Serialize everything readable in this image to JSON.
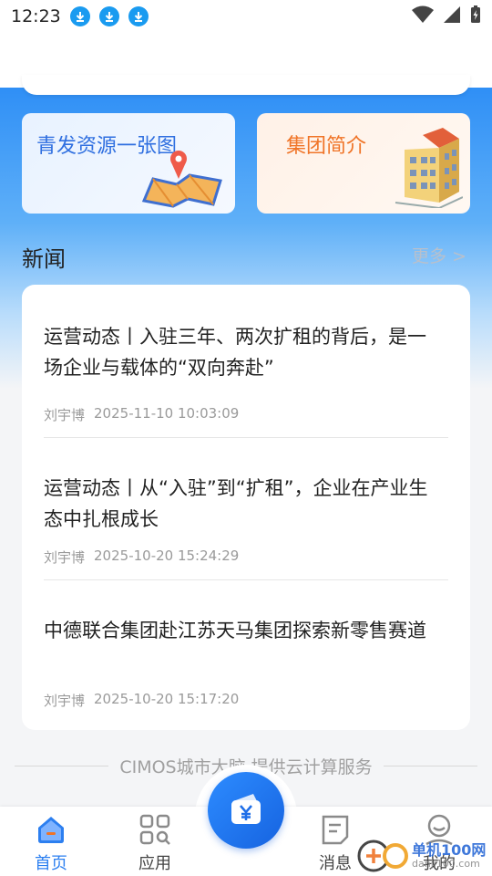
{
  "status_bar": {
    "time": "12:23"
  },
  "cards": [
    {
      "title": "青发资源一张图",
      "art": "map-pin-icon"
    },
    {
      "title": "集团简介",
      "art": "building-icon"
    }
  ],
  "news_section": {
    "title": "新闻",
    "more_label": "更多 >",
    "items": [
      {
        "title": "运营动态丨入驻三年、两次扩租的背后，是一场企业与载体的“双向奔赴”",
        "author": "刘宇博",
        "time": "2025-11-10 10:03:09"
      },
      {
        "title": "运营动态丨从“入驻”到“扩租”，企业在产业生态中扎根成长",
        "author": "刘宇博",
        "time": "2025-10-20 15:24:29"
      },
      {
        "title": "中德联合集团赴江苏天马集团探索新零售赛道",
        "author": "刘宇博",
        "time": "2025-10-20 15:17:20"
      }
    ]
  },
  "footer": {
    "text": "CIMOS城市大脑 提供云计算服务"
  },
  "tabbar": {
    "items": [
      {
        "label": "首页",
        "icon": "home-icon",
        "active": true
      },
      {
        "label": "应用",
        "icon": "apps-grid-icon",
        "active": false
      },
      {
        "label": "消息",
        "icon": "message-icon",
        "active": false
      },
      {
        "label": "我的",
        "icon": "profile-icon",
        "active": false
      }
    ],
    "center_icon": "wallet-yuan-icon"
  },
  "watermark": {
    "text": "单机100网",
    "sub": "danji100.com"
  },
  "colors": {
    "accent": "#2c7ff0",
    "hero_top": "#2f8ff6",
    "orange": "#f07427"
  }
}
